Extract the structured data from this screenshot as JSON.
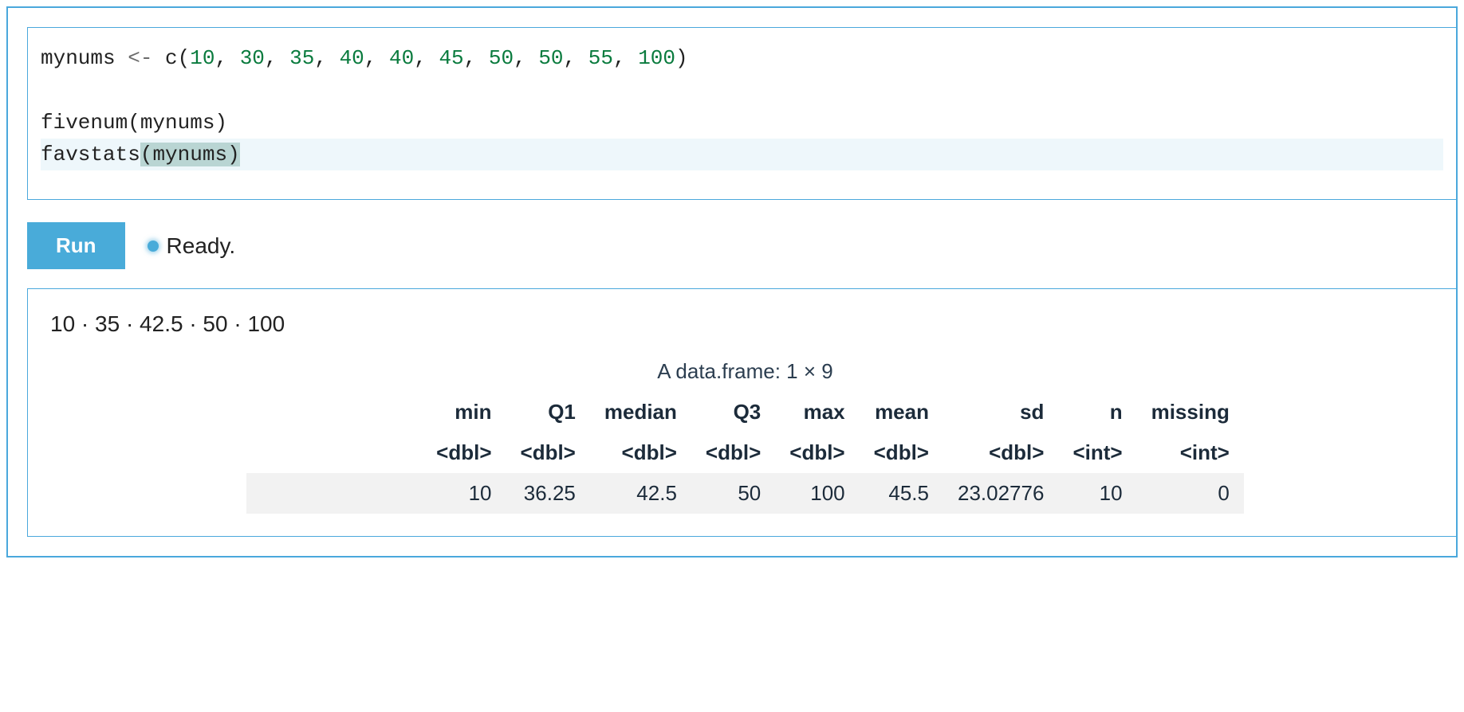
{
  "code": {
    "line1_prefix": "mynums ",
    "line1_assign": "<-",
    "line1_c": " c",
    "line1_open": "(",
    "line1_nums": [
      "10",
      "30",
      "35",
      "40",
      "40",
      "45",
      "50",
      "50",
      "55",
      "100"
    ],
    "line1_close": ")",
    "line3": "fivenum(mynums)",
    "line4_fn": "favstats",
    "line4_open": "(",
    "line4_arg": "mynums",
    "line4_close": ")"
  },
  "controls": {
    "run_label": "Run",
    "status_text": "Ready."
  },
  "output": {
    "fivenum": "10 · 35 · 42.5 · 50 · 100",
    "caption": "A data.frame: 1 × 9",
    "columns": [
      "min",
      "Q1",
      "median",
      "Q3",
      "max",
      "mean",
      "sd",
      "n",
      "missing"
    ],
    "types": [
      "<dbl>",
      "<dbl>",
      "<dbl>",
      "<dbl>",
      "<dbl>",
      "<dbl>",
      "<dbl>",
      "<int>",
      "<int>"
    ],
    "row": [
      "10",
      "36.25",
      "42.5",
      "50",
      "100",
      "45.5",
      "23.02776",
      "10",
      "0"
    ]
  }
}
